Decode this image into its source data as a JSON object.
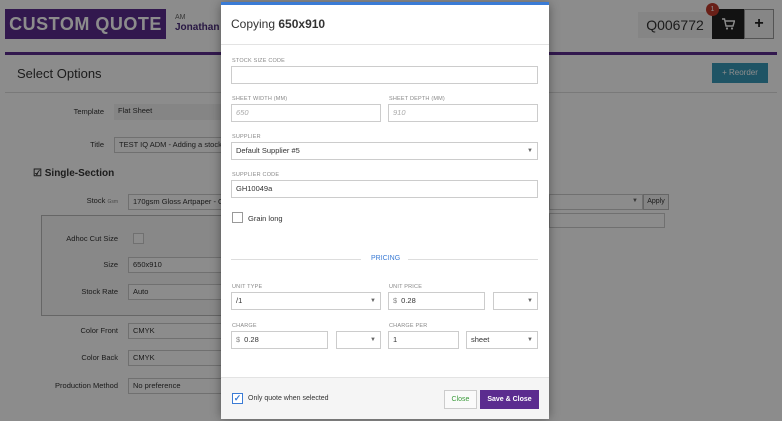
{
  "app": {
    "brand": "CUSTOM QUOTE",
    "am_label": "AM",
    "user": "Jonathan",
    "quote_id": "Q006772",
    "cart_count": "1",
    "plus_label": "+"
  },
  "page": {
    "section_title": "Select Options",
    "reorder_label": "+ Reorder",
    "template_label": "Template",
    "template_value": "Flat Sheet",
    "title_label": "Title",
    "title_value": "TEST IQ ADM - Adding a stock",
    "single_section": "Single-Section",
    "stock_label": "Stock",
    "stock_sublabel": "Gsm",
    "stock_value": "170gsm Gloss Artpaper - Gl",
    "apply_label": "Apply",
    "adhoc_label": "Adhoc Cut Size",
    "size_label": "Size",
    "size_value": "650x910",
    "stock_rate_label": "Stock Rate",
    "stock_rate_value": "Auto",
    "color_front_label": "Color Front",
    "color_front_value": "CMYK",
    "color_back_label": "Color Back",
    "color_back_value": "CMYK",
    "production_method_label": "Production Method",
    "production_method_value": "No preference"
  },
  "modal": {
    "title_prefix": "Copying ",
    "title_bold": "650x910",
    "stock_size_code_label": "STOCK SIZE CODE",
    "stock_size_code_value": "",
    "sheet_width_label": "SHEET WIDTH (MM)",
    "sheet_width_placeholder": "650",
    "sheet_depth_label": "SHEET DEPTH (MM)",
    "sheet_depth_placeholder": "910",
    "supplier_label": "SUPPLIER",
    "supplier_value": "Default Supplier #5",
    "supplier_code_label": "SUPPLIER CODE",
    "supplier_code_value": "GH10049a",
    "grain_long_label": "Grain long",
    "pricing_label": "PRICING",
    "unit_type_label": "UNIT TYPE",
    "unit_type_value": "/1",
    "unit_price_label": "UNIT PRICE",
    "unit_price_currency": "$",
    "unit_price_value": "0.28",
    "charge_label": "CHARGE",
    "charge_currency": "$",
    "charge_value": "0.28",
    "charge_per_label": "CHARGE PER",
    "charge_per_value": "1",
    "charge_per_unit": "sheet",
    "only_quote_label": "Only quote when selected",
    "only_quote_checked": "✓",
    "close_label": "Close",
    "save_close_label": "Save & Close"
  }
}
